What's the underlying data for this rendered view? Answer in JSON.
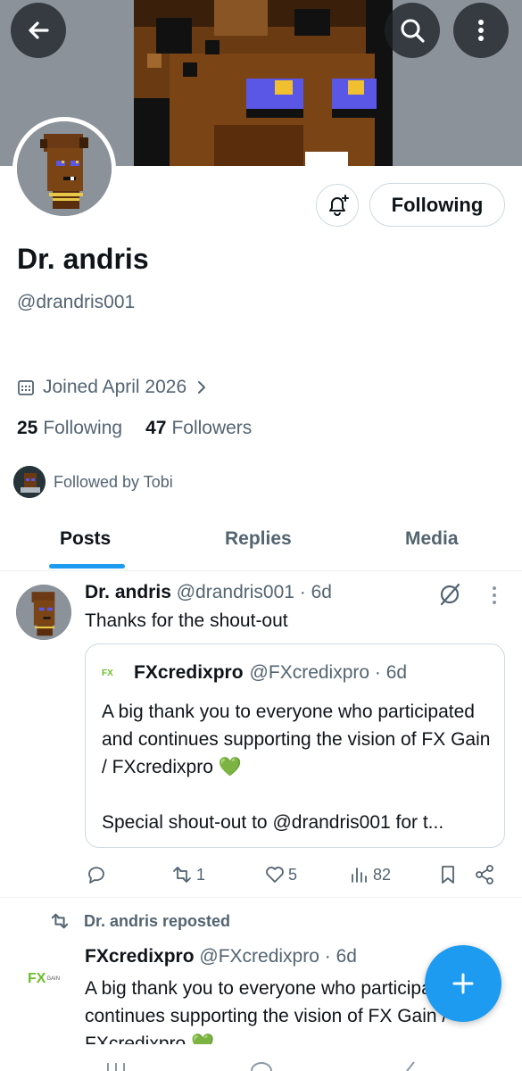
{
  "profile": {
    "name": "Dr. andris",
    "handle": "@drandris001",
    "joined": "Joined April 2026",
    "following_count": "25",
    "following_label": "Following",
    "followers_count": "47",
    "followers_label": "Followers",
    "followed_by": "Followed by Tobi"
  },
  "actions": {
    "following_button": "Following"
  },
  "tabs": [
    {
      "label": "Posts"
    },
    {
      "label": "Replies"
    },
    {
      "label": "Media"
    }
  ],
  "post1": {
    "author": "Dr. andris",
    "meta": "@drandris001 · 6d",
    "text": "Thanks for the shout-out",
    "quote": {
      "logo": "FX",
      "author": "FXcredixpro",
      "meta": "@FXcredixpro · 6d",
      "line1": "A big thank you to everyone who participated and continues supporting the vision of FX Gain / FXcredixpro 💚",
      "line2": "Special shout-out to @drandris001 for t..."
    },
    "stats": {
      "reposts": "1",
      "likes": "5",
      "views": "82"
    }
  },
  "post2": {
    "repost_label": "Dr. andris reposted",
    "author": "FXcredixpro",
    "meta": "@FXcredixpro · 6d",
    "text": "A big thank you to everyone who participated and continues supporting the vision of FX Gain / FXcredixpro 💚",
    "logo_main": "FX",
    "logo_sub": "GAIN"
  },
  "colors": {
    "accent": "#1d9bf0",
    "muted": "#536471",
    "text": "#0f1419",
    "border": "#cfd9de",
    "brand_green": "#6cbf2a"
  },
  "icons": [
    "back-arrow-icon",
    "search-icon",
    "more-vertical-icon",
    "notification-bell-icon",
    "calendar-icon",
    "chevron-right-icon",
    "grok-icon",
    "reply-icon",
    "repost-icon",
    "like-icon",
    "views-icon",
    "bookmark-icon",
    "share-icon",
    "plus-icon"
  ]
}
